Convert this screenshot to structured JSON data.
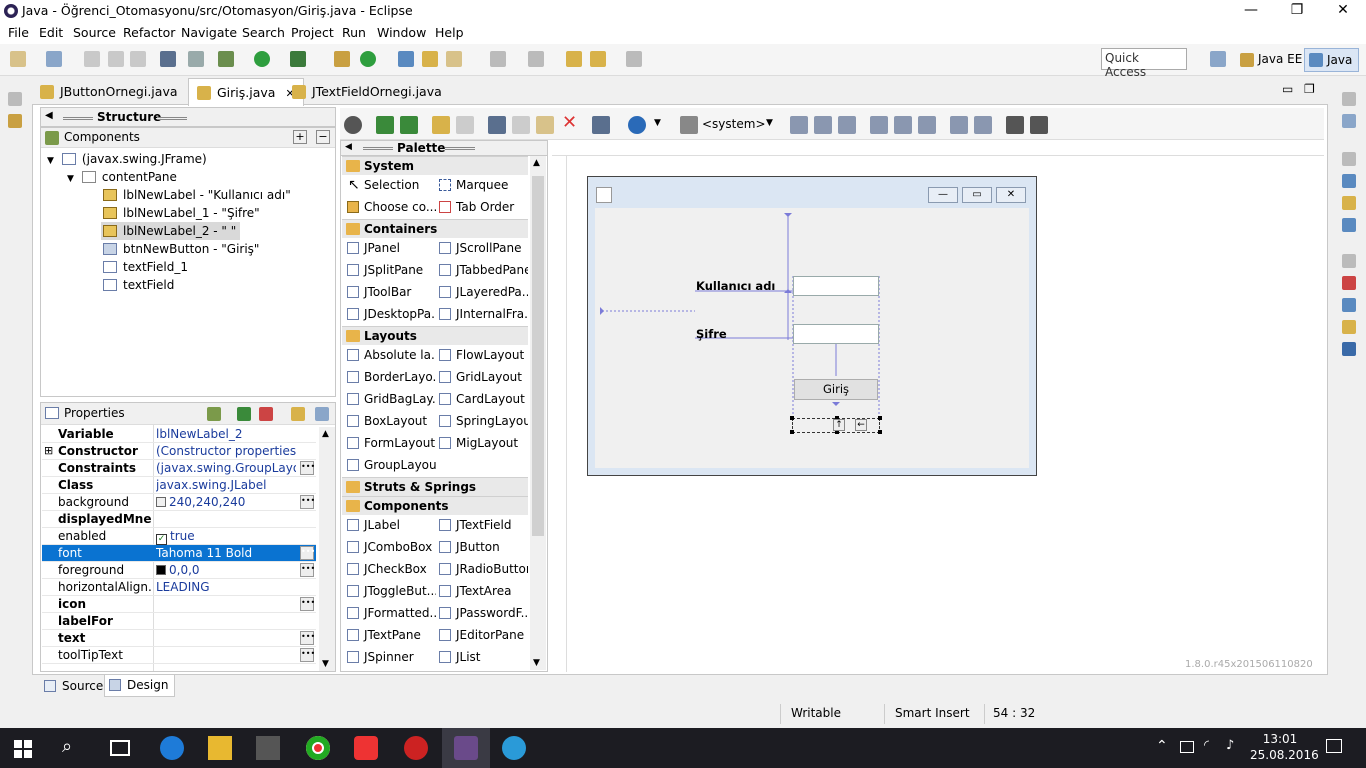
{
  "window": {
    "title": "Java - Öğrenci_Otomasyonu/src/Otomasyon/Giriş.java - Eclipse"
  },
  "menu": [
    "File",
    "Edit",
    "Source",
    "Refactor",
    "Navigate",
    "Search",
    "Project",
    "Run",
    "Window",
    "Help"
  ],
  "toolbar": {
    "quick_access": "Quick Access",
    "perspectives": [
      "Java EE",
      "Java"
    ]
  },
  "tabs": [
    {
      "label": "JButtonOrnegi.java",
      "active": false
    },
    {
      "label": "Giriş.java",
      "active": true
    },
    {
      "label": "JTextFieldOrnegi.java",
      "active": false
    }
  ],
  "structure": {
    "title": "Structure",
    "components_label": "Components",
    "tree": [
      {
        "label": "(javax.swing.JFrame)",
        "level": 0
      },
      {
        "label": "contentPane",
        "level": 1
      },
      {
        "label": "lblNewLabel - \"Kullanıcı adı\"",
        "level": 2
      },
      {
        "label": "lblNewLabel_1 - \"Şifre\"",
        "level": 2
      },
      {
        "label": "lblNewLabel_2 - \" \"",
        "level": 2,
        "selected": true
      },
      {
        "label": "btnNewButton - \"Giriş\"",
        "level": 2
      },
      {
        "label": "textField_1",
        "level": 2
      },
      {
        "label": "textField",
        "level": 2
      }
    ]
  },
  "properties": {
    "title": "Properties",
    "rows": [
      {
        "key": "Variable",
        "value": "lblNewLabel_2",
        "bold": true
      },
      {
        "key": "Constructor",
        "value": "(Constructor properties)",
        "bold": true,
        "expand": true
      },
      {
        "key": "Constraints",
        "value": "(javax.swing.GroupLayout)",
        "bold": true,
        "dots": true
      },
      {
        "key": "Class",
        "value": "javax.swing.JLabel",
        "bold": true
      },
      {
        "key": "background",
        "value": "240,240,240",
        "dots": true,
        "swatch": "#f0f0f0"
      },
      {
        "key": "displayedMne...",
        "value": "",
        "bold": true
      },
      {
        "key": "enabled",
        "value": "true",
        "check": true
      },
      {
        "key": "font",
        "value": "Tahoma 11 Bold",
        "selected": true,
        "dots": true
      },
      {
        "key": "foreground",
        "value": "0,0,0",
        "dots": true,
        "swatch": "#000000"
      },
      {
        "key": "horizontalAlign...",
        "value": "LEADING"
      },
      {
        "key": "icon",
        "value": "",
        "bold": true,
        "dots": true
      },
      {
        "key": "labelFor",
        "value": "",
        "bold": true
      },
      {
        "key": "text",
        "value": "",
        "bold": true,
        "dots": true
      },
      {
        "key": "toolTipText",
        "value": "",
        "dots": true
      }
    ]
  },
  "palette": {
    "title": "Palette",
    "system": {
      "label": "System",
      "items": [
        "Selection",
        "Marquee",
        "Choose co...",
        "Tab Order"
      ]
    },
    "containers": {
      "label": "Containers",
      "items": [
        "JPanel",
        "JScrollPane",
        "JSplitPane",
        "JTabbedPane",
        "JToolBar",
        "JLayeredPa...",
        "JDesktopPa...",
        "JInternalFra..."
      ]
    },
    "layouts": {
      "label": "Layouts",
      "items": [
        "Absolute la...",
        "FlowLayout",
        "BorderLayo...",
        "GridLayout",
        "GridBagLay...",
        "CardLayout",
        "BoxLayout",
        "SpringLayout",
        "FormLayout",
        "MigLayout",
        "GroupLayout"
      ]
    },
    "struts": {
      "label": "Struts & Springs"
    },
    "components": {
      "label": "Components",
      "items": [
        "JLabel",
        "JTextField",
        "JComboBox",
        "JButton",
        "JCheckBox",
        "JRadioButton",
        "JToggleBut...",
        "JTextArea",
        "JFormatted...",
        "JPasswordF...",
        "JTextPane",
        "JEditorPane",
        "JSpinner",
        "JList"
      ]
    }
  },
  "design_toolbar": {
    "lookandfeel": "<system>"
  },
  "form": {
    "label_user": "Kullanıcı adı",
    "label_pass": "Şifre",
    "button": "Giriş"
  },
  "version": "1.8.0.r45x201506110820",
  "bottom_tabs": [
    "Source",
    "Design"
  ],
  "status": {
    "writable": "Writable",
    "insert": "Smart Insert",
    "position": "54 : 32"
  },
  "taskbar": {
    "time": "13:01",
    "date": "25.08.2016"
  },
  "colors": {
    "selection": "#0a73d1",
    "link": "#1a3b9c",
    "taskbar": "#1c1c22"
  }
}
